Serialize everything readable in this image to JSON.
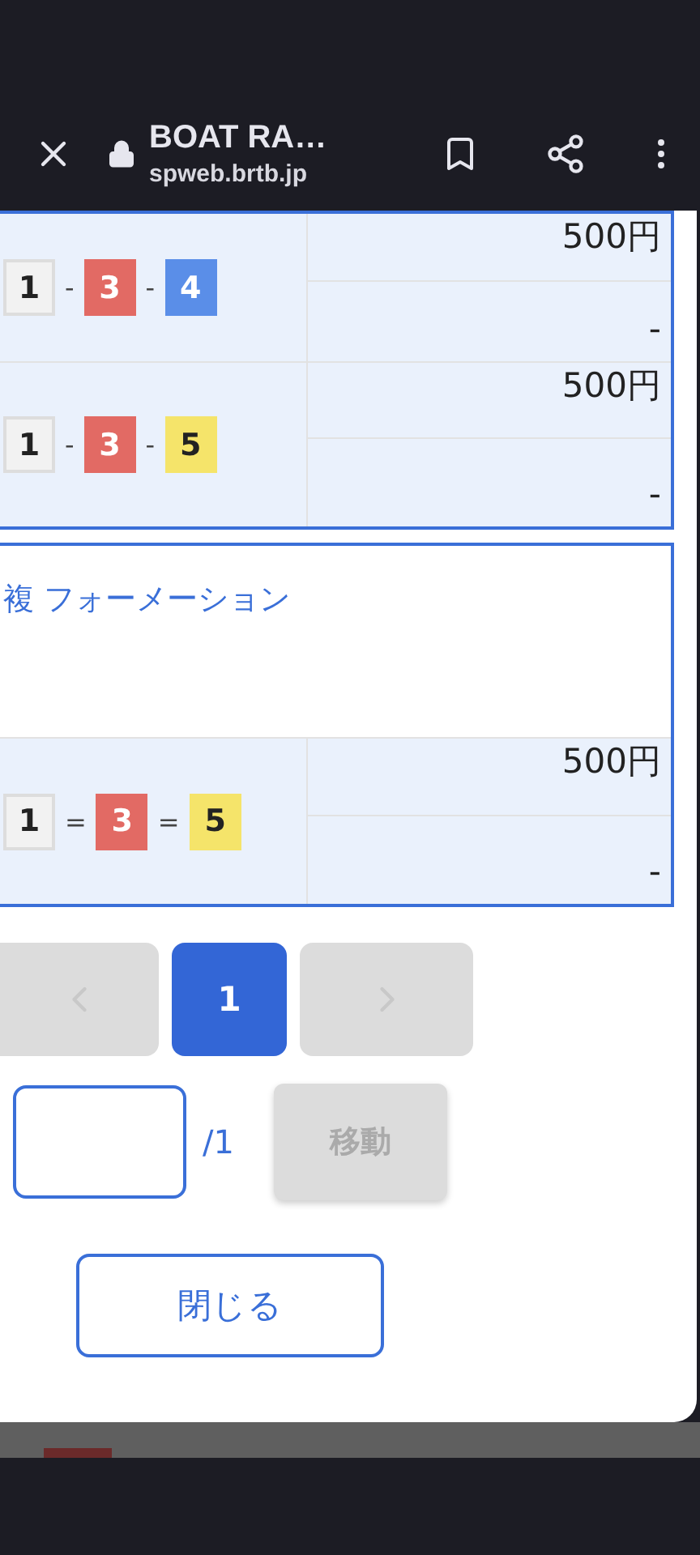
{
  "browser": {
    "title": "BOAT RA…",
    "url": "spweb.brtb.jp"
  },
  "groups": [
    {
      "rows": [
        {
          "separator": "-",
          "amount": "500円",
          "payout": "-",
          "boats": [
            {
              "number": "1",
              "color": "#f2f2f2"
            },
            {
              "number": "3",
              "color": "#e26a64"
            },
            {
              "number": "4",
              "color": "#5a8ee8"
            }
          ]
        },
        {
          "separator": "-",
          "amount": "500円",
          "payout": "-",
          "boats": [
            {
              "number": "1",
              "color": "#f2f2f2"
            },
            {
              "number": "3",
              "color": "#e26a64"
            },
            {
              "number": "5",
              "color": "#f5e46a"
            }
          ]
        }
      ]
    },
    {
      "title": "複 フォーメーション",
      "rows": [
        {
          "separator": "=",
          "amount": "500円",
          "payout": "-",
          "boats": [
            {
              "number": "1",
              "color": "#f2f2f2"
            },
            {
              "number": "3",
              "color": "#e26a64"
            },
            {
              "number": "5",
              "color": "#f5e46a"
            }
          ]
        }
      ]
    }
  ],
  "pagination": {
    "prev_disabled": true,
    "next_disabled": true,
    "pages": [
      {
        "label": "1",
        "selected": true
      }
    ]
  },
  "jump": {
    "total": "/1",
    "button": "移動",
    "button_disabled": true
  },
  "close_button": "閉じる"
}
